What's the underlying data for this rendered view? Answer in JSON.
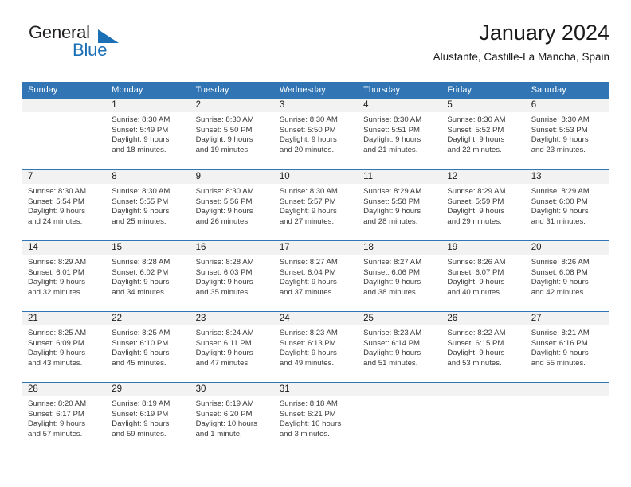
{
  "brand": {
    "word1": "General",
    "word2": "Blue",
    "accent_color": "#1a6fb5"
  },
  "header": {
    "title": "January 2024",
    "location": "Alustante, Castille-La Mancha, Spain"
  },
  "theme": {
    "header_blue": "#3175b4",
    "daynum_band": "#f2f2f2",
    "text": "#1a1a1a"
  },
  "weekdays": [
    "Sunday",
    "Monday",
    "Tuesday",
    "Wednesday",
    "Thursday",
    "Friday",
    "Saturday"
  ],
  "weeks": [
    [
      {
        "day": "",
        "lines": []
      },
      {
        "day": "1",
        "lines": [
          "Sunrise: 8:30 AM",
          "Sunset: 5:49 PM",
          "Daylight: 9 hours",
          "and 18 minutes."
        ]
      },
      {
        "day": "2",
        "lines": [
          "Sunrise: 8:30 AM",
          "Sunset: 5:50 PM",
          "Daylight: 9 hours",
          "and 19 minutes."
        ]
      },
      {
        "day": "3",
        "lines": [
          "Sunrise: 8:30 AM",
          "Sunset: 5:50 PM",
          "Daylight: 9 hours",
          "and 20 minutes."
        ]
      },
      {
        "day": "4",
        "lines": [
          "Sunrise: 8:30 AM",
          "Sunset: 5:51 PM",
          "Daylight: 9 hours",
          "and 21 minutes."
        ]
      },
      {
        "day": "5",
        "lines": [
          "Sunrise: 8:30 AM",
          "Sunset: 5:52 PM",
          "Daylight: 9 hours",
          "and 22 minutes."
        ]
      },
      {
        "day": "6",
        "lines": [
          "Sunrise: 8:30 AM",
          "Sunset: 5:53 PM",
          "Daylight: 9 hours",
          "and 23 minutes."
        ]
      }
    ],
    [
      {
        "day": "7",
        "lines": [
          "Sunrise: 8:30 AM",
          "Sunset: 5:54 PM",
          "Daylight: 9 hours",
          "and 24 minutes."
        ]
      },
      {
        "day": "8",
        "lines": [
          "Sunrise: 8:30 AM",
          "Sunset: 5:55 PM",
          "Daylight: 9 hours",
          "and 25 minutes."
        ]
      },
      {
        "day": "9",
        "lines": [
          "Sunrise: 8:30 AM",
          "Sunset: 5:56 PM",
          "Daylight: 9 hours",
          "and 26 minutes."
        ]
      },
      {
        "day": "10",
        "lines": [
          "Sunrise: 8:30 AM",
          "Sunset: 5:57 PM",
          "Daylight: 9 hours",
          "and 27 minutes."
        ]
      },
      {
        "day": "11",
        "lines": [
          "Sunrise: 8:29 AM",
          "Sunset: 5:58 PM",
          "Daylight: 9 hours",
          "and 28 minutes."
        ]
      },
      {
        "day": "12",
        "lines": [
          "Sunrise: 8:29 AM",
          "Sunset: 5:59 PM",
          "Daylight: 9 hours",
          "and 29 minutes."
        ]
      },
      {
        "day": "13",
        "lines": [
          "Sunrise: 8:29 AM",
          "Sunset: 6:00 PM",
          "Daylight: 9 hours",
          "and 31 minutes."
        ]
      }
    ],
    [
      {
        "day": "14",
        "lines": [
          "Sunrise: 8:29 AM",
          "Sunset: 6:01 PM",
          "Daylight: 9 hours",
          "and 32 minutes."
        ]
      },
      {
        "day": "15",
        "lines": [
          "Sunrise: 8:28 AM",
          "Sunset: 6:02 PM",
          "Daylight: 9 hours",
          "and 34 minutes."
        ]
      },
      {
        "day": "16",
        "lines": [
          "Sunrise: 8:28 AM",
          "Sunset: 6:03 PM",
          "Daylight: 9 hours",
          "and 35 minutes."
        ]
      },
      {
        "day": "17",
        "lines": [
          "Sunrise: 8:27 AM",
          "Sunset: 6:04 PM",
          "Daylight: 9 hours",
          "and 37 minutes."
        ]
      },
      {
        "day": "18",
        "lines": [
          "Sunrise: 8:27 AM",
          "Sunset: 6:06 PM",
          "Daylight: 9 hours",
          "and 38 minutes."
        ]
      },
      {
        "day": "19",
        "lines": [
          "Sunrise: 8:26 AM",
          "Sunset: 6:07 PM",
          "Daylight: 9 hours",
          "and 40 minutes."
        ]
      },
      {
        "day": "20",
        "lines": [
          "Sunrise: 8:26 AM",
          "Sunset: 6:08 PM",
          "Daylight: 9 hours",
          "and 42 minutes."
        ]
      }
    ],
    [
      {
        "day": "21",
        "lines": [
          "Sunrise: 8:25 AM",
          "Sunset: 6:09 PM",
          "Daylight: 9 hours",
          "and 43 minutes."
        ]
      },
      {
        "day": "22",
        "lines": [
          "Sunrise: 8:25 AM",
          "Sunset: 6:10 PM",
          "Daylight: 9 hours",
          "and 45 minutes."
        ]
      },
      {
        "day": "23",
        "lines": [
          "Sunrise: 8:24 AM",
          "Sunset: 6:11 PM",
          "Daylight: 9 hours",
          "and 47 minutes."
        ]
      },
      {
        "day": "24",
        "lines": [
          "Sunrise: 8:23 AM",
          "Sunset: 6:13 PM",
          "Daylight: 9 hours",
          "and 49 minutes."
        ]
      },
      {
        "day": "25",
        "lines": [
          "Sunrise: 8:23 AM",
          "Sunset: 6:14 PM",
          "Daylight: 9 hours",
          "and 51 minutes."
        ]
      },
      {
        "day": "26",
        "lines": [
          "Sunrise: 8:22 AM",
          "Sunset: 6:15 PM",
          "Daylight: 9 hours",
          "and 53 minutes."
        ]
      },
      {
        "day": "27",
        "lines": [
          "Sunrise: 8:21 AM",
          "Sunset: 6:16 PM",
          "Daylight: 9 hours",
          "and 55 minutes."
        ]
      }
    ],
    [
      {
        "day": "28",
        "lines": [
          "Sunrise: 8:20 AM",
          "Sunset: 6:17 PM",
          "Daylight: 9 hours",
          "and 57 minutes."
        ]
      },
      {
        "day": "29",
        "lines": [
          "Sunrise: 8:19 AM",
          "Sunset: 6:19 PM",
          "Daylight: 9 hours",
          "and 59 minutes."
        ]
      },
      {
        "day": "30",
        "lines": [
          "Sunrise: 8:19 AM",
          "Sunset: 6:20 PM",
          "Daylight: 10 hours",
          "and 1 minute."
        ]
      },
      {
        "day": "31",
        "lines": [
          "Sunrise: 8:18 AM",
          "Sunset: 6:21 PM",
          "Daylight: 10 hours",
          "and 3 minutes."
        ]
      },
      {
        "day": "",
        "lines": []
      },
      {
        "day": "",
        "lines": []
      },
      {
        "day": "",
        "lines": []
      }
    ]
  ]
}
